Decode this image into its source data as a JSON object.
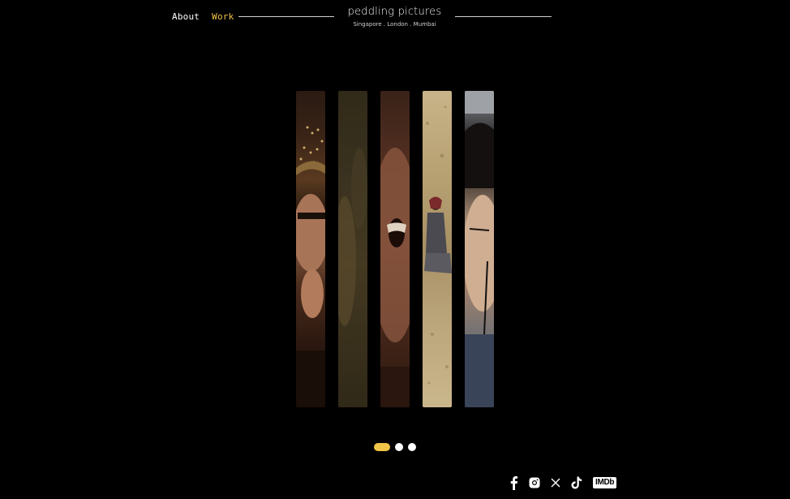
{
  "nav": {
    "about": "About",
    "work": "Work",
    "active": "Work"
  },
  "brand": {
    "title": "peddling pictures",
    "subtitle": "Singapore . London . Mumbai"
  },
  "gallery": {
    "strips": [
      {
        "subject": "man-with-hand-on-chin-under-chandelier"
      },
      {
        "subject": "blurred-figure-dim-light"
      },
      {
        "subject": "close-up-laughing-face"
      },
      {
        "subject": "woman-sitting-on-sand"
      },
      {
        "subject": "young-man-holding-pen"
      }
    ]
  },
  "pager": {
    "count": 3,
    "active_index": 0
  },
  "social": {
    "items": [
      "facebook-icon",
      "instagram-icon",
      "x-icon",
      "tiktok-icon",
      "imdb-icon"
    ],
    "imdb_label": "IMDb"
  },
  "colors": {
    "accent": "#f2c447",
    "background": "#000000",
    "text": "#ffffff"
  }
}
